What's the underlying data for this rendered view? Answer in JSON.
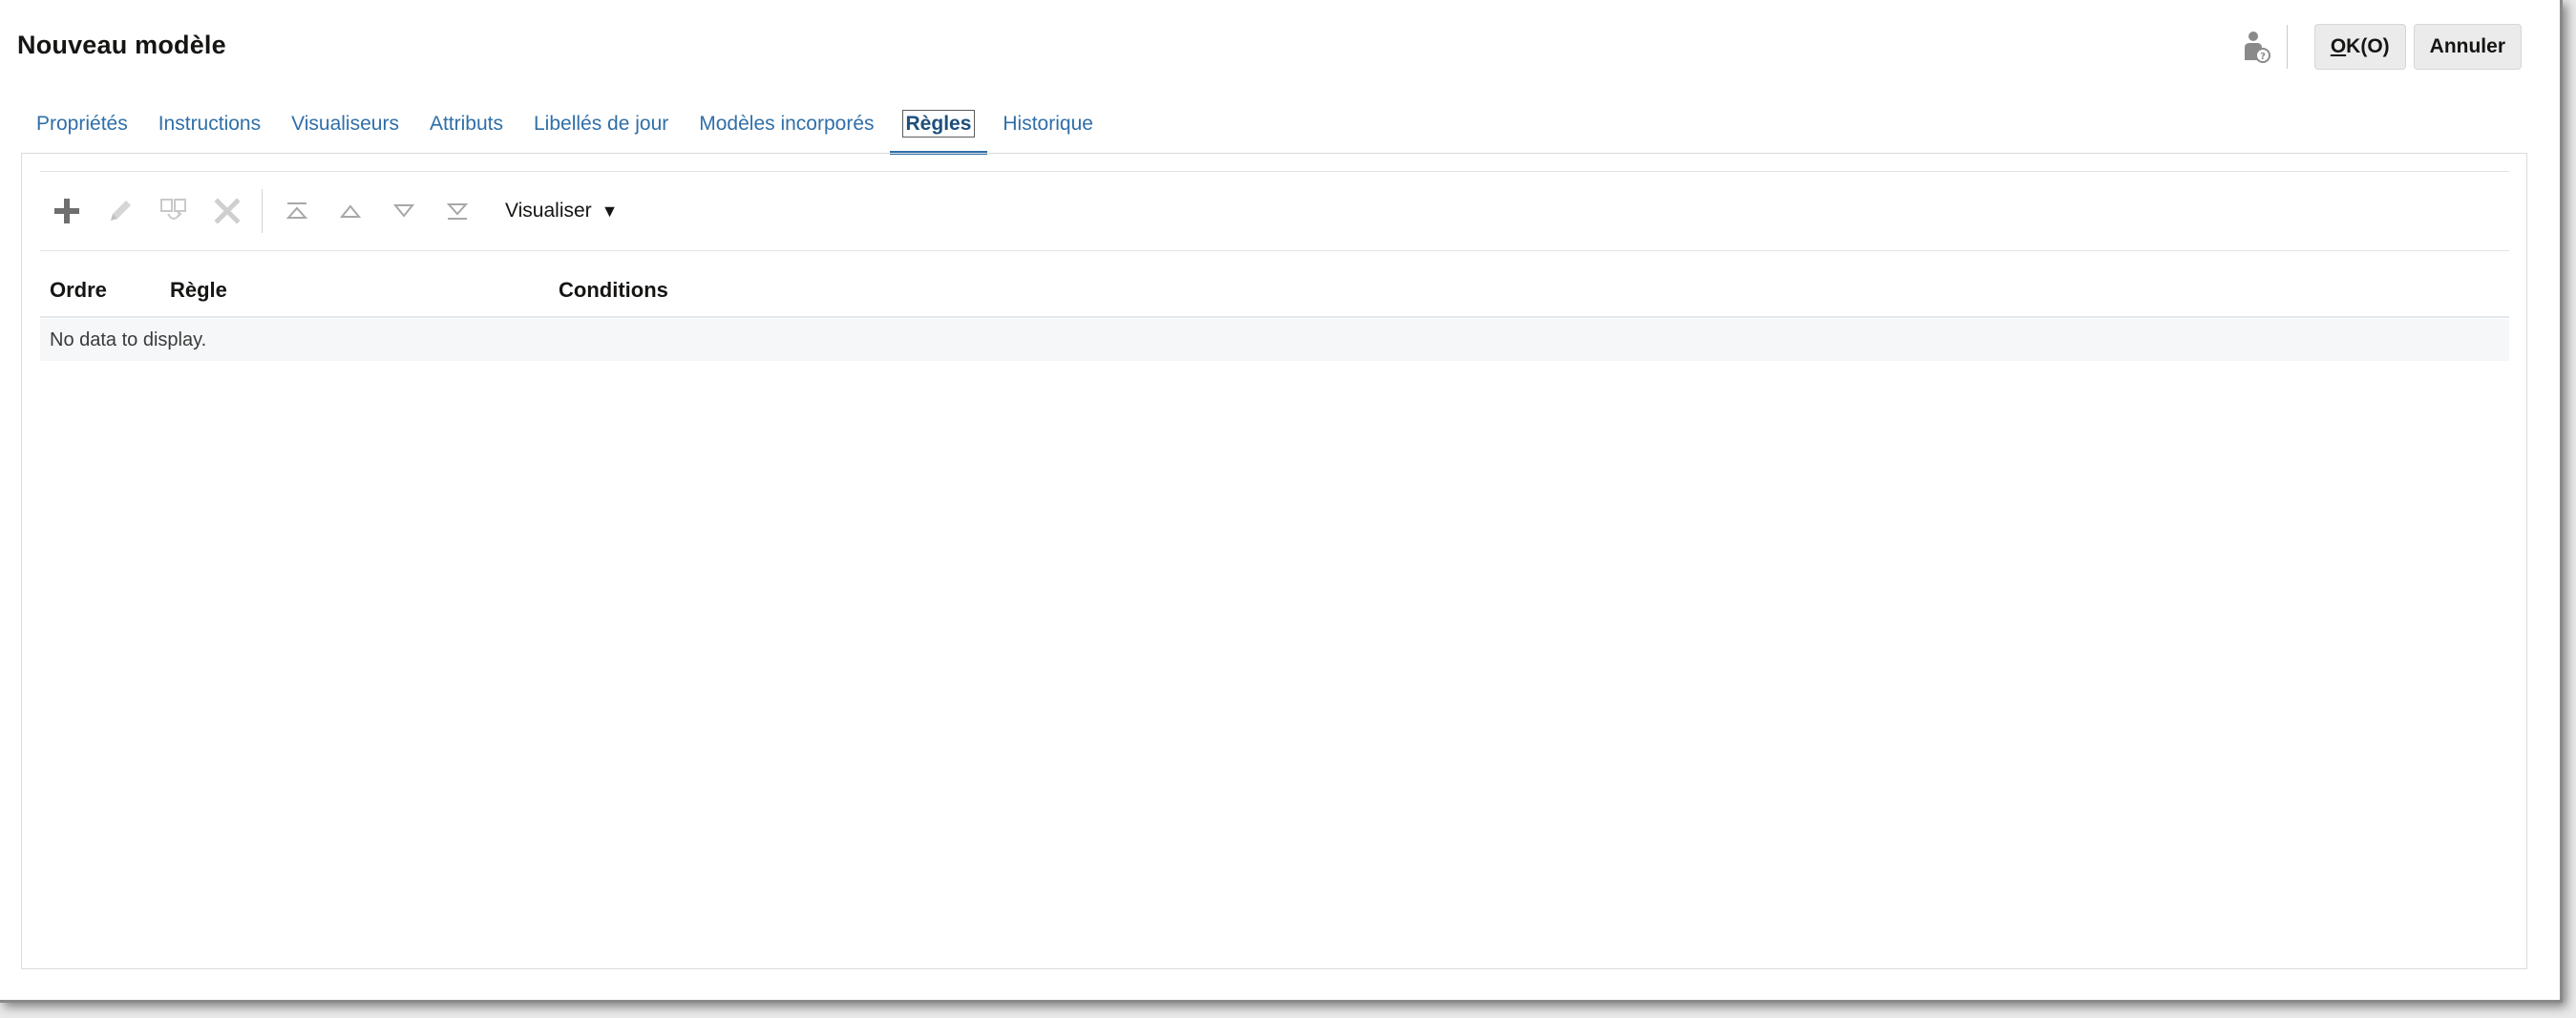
{
  "dialog": {
    "title": "Nouveau modèle",
    "ok_label_accel": "O",
    "ok_label_rest": "K(O)",
    "cancel_label": "Annuler"
  },
  "tabs": [
    {
      "label": "Propriétés"
    },
    {
      "label": "Instructions"
    },
    {
      "label": "Visualiseurs"
    },
    {
      "label": "Attributs"
    },
    {
      "label": "Libellés de jour"
    },
    {
      "label": "Modèles incorporés"
    },
    {
      "label": "Règles",
      "active": true
    },
    {
      "label": "Historique"
    }
  ],
  "toolbar": {
    "icons": [
      "add-icon",
      "edit-icon",
      "duplicate-icon",
      "delete-icon",
      "move-to-top-icon",
      "move-up-icon",
      "move-down-icon",
      "move-to-bottom-icon"
    ],
    "view_label": "Visualiser"
  },
  "table": {
    "columns": [
      "Ordre",
      "Règle",
      "Conditions"
    ],
    "empty_text": "No data to display."
  },
  "colors": {
    "tab_link": "#2f6fa8",
    "tab_active": "#1d4f7c",
    "button_bg": "#ebebeb"
  }
}
